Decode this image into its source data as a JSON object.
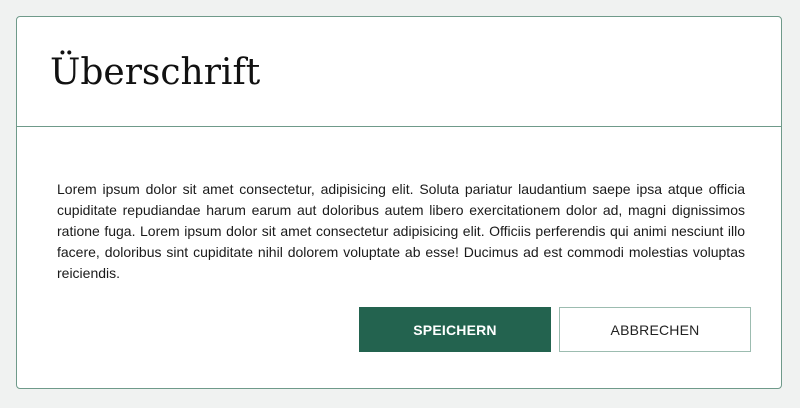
{
  "dialog": {
    "title": "Überschrift",
    "body": "Lorem ipsum dolor sit amet consectetur, adipisicing elit. Soluta pariatur laudantium saepe ipsa atque officia cupiditate repudiandae harum earum aut doloribus autem libero exercitationem dolor ad, magni dignissimos ratione fuga. Lorem ipsum dolor sit amet consectetur adipisicing elit. Officiis perferendis qui animi nesciunt illo facere, doloribus sint cupiditate nihil dolorem voluptate ab esse! Ducimus ad est commodi molestias voluptas reiciendis.",
    "buttons": {
      "save_label": "SPEICHERN",
      "cancel_label": "ABBRECHEN"
    }
  },
  "colors": {
    "accent": "#23634f",
    "border": "#6f9a8a",
    "background": "#ffffff"
  }
}
